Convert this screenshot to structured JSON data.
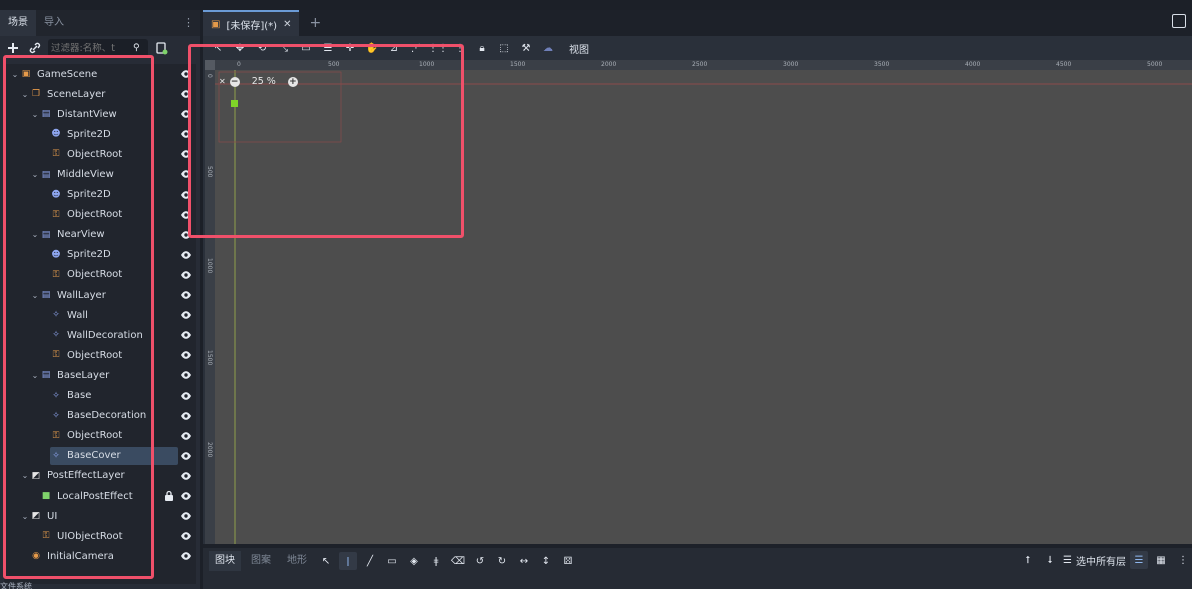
{
  "left_dock": {
    "tabs": [
      {
        "label": "场景"
      },
      {
        "label": "导入"
      }
    ],
    "filter_placeholder": "过滤器:名称、t",
    "bottom_label": "文件系统"
  },
  "tree": [
    {
      "label": "GameScene",
      "depth": 0,
      "icon": "node2d-scene-icon",
      "color": "#e59a4a",
      "caret": "v"
    },
    {
      "label": "SceneLayer",
      "depth": 1,
      "icon": "layer-icon",
      "color": "#e59a4a",
      "caret": "v"
    },
    {
      "label": "DistantView",
      "depth": 2,
      "icon": "parallax-icon",
      "color": "#8ea6f0",
      "caret": "v"
    },
    {
      "label": "Sprite2D",
      "depth": 3,
      "icon": "sprite-icon",
      "color": "#8ea6f0",
      "caret": ""
    },
    {
      "label": "ObjectRoot",
      "depth": 3,
      "icon": "node-tree-icon",
      "color": "#e59a4a",
      "caret": ""
    },
    {
      "label": "MiddleView",
      "depth": 2,
      "icon": "parallax-icon",
      "color": "#8ea6f0",
      "caret": "v"
    },
    {
      "label": "Sprite2D",
      "depth": 3,
      "icon": "sprite-icon",
      "color": "#8ea6f0",
      "caret": ""
    },
    {
      "label": "ObjectRoot",
      "depth": 3,
      "icon": "node-tree-icon",
      "color": "#e59a4a",
      "caret": ""
    },
    {
      "label": "NearView",
      "depth": 2,
      "icon": "parallax-icon",
      "color": "#8ea6f0",
      "caret": "v"
    },
    {
      "label": "Sprite2D",
      "depth": 3,
      "icon": "sprite-icon",
      "color": "#8ea6f0",
      "caret": ""
    },
    {
      "label": "ObjectRoot",
      "depth": 3,
      "icon": "node-tree-icon",
      "color": "#e59a4a",
      "caret": ""
    },
    {
      "label": "WallLayer",
      "depth": 2,
      "icon": "parallax-icon",
      "color": "#8ea6f0",
      "caret": "v"
    },
    {
      "label": "Wall",
      "depth": 3,
      "icon": "tilemap-icon",
      "color": "#8ea6f0",
      "caret": ""
    },
    {
      "label": "WallDecoration",
      "depth": 3,
      "icon": "tilemap-icon",
      "color": "#8ea6f0",
      "caret": ""
    },
    {
      "label": "ObjectRoot",
      "depth": 3,
      "icon": "node-tree-icon",
      "color": "#e59a4a",
      "caret": ""
    },
    {
      "label": "BaseLayer",
      "depth": 2,
      "icon": "parallax-icon",
      "color": "#8ea6f0",
      "caret": "v"
    },
    {
      "label": "Base",
      "depth": 3,
      "icon": "tilemap-icon",
      "color": "#8ea6f0",
      "caret": ""
    },
    {
      "label": "BaseDecoration",
      "depth": 3,
      "icon": "tilemap-icon",
      "color": "#8ea6f0",
      "caret": ""
    },
    {
      "label": "ObjectRoot",
      "depth": 3,
      "icon": "node-tree-icon",
      "color": "#e59a4a",
      "caret": ""
    },
    {
      "label": "BaseCover",
      "depth": 3,
      "icon": "tilemap-icon",
      "color": "#8ea6f0",
      "caret": "",
      "selected": true
    },
    {
      "label": "PostEffectLayer",
      "depth": 1,
      "icon": "canvas-layer-icon",
      "color": "#e6e6e6",
      "caret": "v"
    },
    {
      "label": "LocalPostEffect",
      "depth": 2,
      "icon": "color-rect-icon",
      "color": "#7fd36b",
      "caret": "",
      "locked": true
    },
    {
      "label": "UI",
      "depth": 1,
      "icon": "canvas-layer-icon",
      "color": "#e6e6e6",
      "caret": "v"
    },
    {
      "label": "UIObjectRoot",
      "depth": 2,
      "icon": "node-tree-icon",
      "color": "#e59a4a",
      "caret": ""
    },
    {
      "label": "InitialCamera",
      "depth": 1,
      "icon": "camera-icon",
      "color": "#e59a4a",
      "caret": ""
    }
  ],
  "main": {
    "tab_label": "[未保存](*)",
    "view_menu": "视图",
    "zoom": "25 %",
    "ruler_x": [
      "0",
      "500",
      "1000",
      "1500",
      "2000",
      "2500",
      "3000",
      "3500",
      "4000",
      "4500",
      "5000"
    ],
    "ruler_y": [
      "0",
      "500",
      "1000",
      "1500",
      "2000"
    ]
  },
  "bottom": {
    "tabs": [
      {
        "label": "图块"
      },
      {
        "label": "图案"
      },
      {
        "label": "地形"
      }
    ],
    "layer_select": "选中所有层"
  },
  "colors": {
    "highlight": "#f0506a",
    "accent": "#6b9bd6"
  }
}
